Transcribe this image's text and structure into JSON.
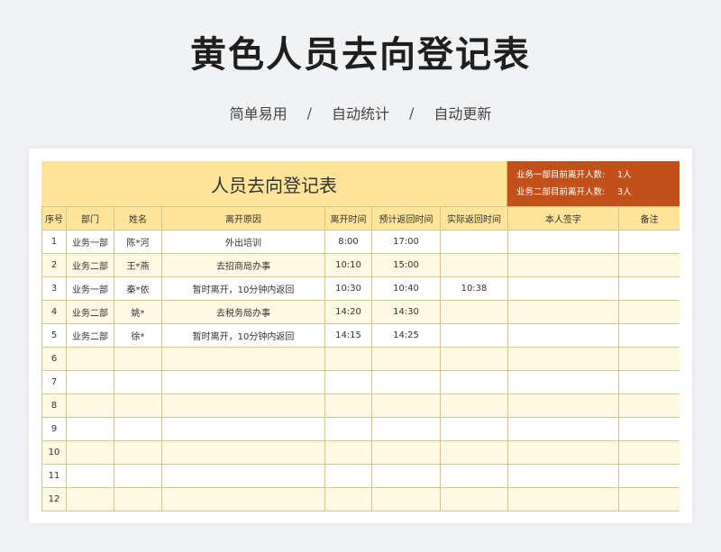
{
  "page": {
    "title": "黄色人员去向登记表",
    "tags": [
      "简单易用",
      "自动统计",
      "自动更新"
    ],
    "separator": "/"
  },
  "sheet": {
    "title": "人员去向登记表",
    "summary": [
      {
        "label": "业务一部目前离开人数:",
        "value": "1人"
      },
      {
        "label": "业务二部目前离开人数:",
        "value": "3人"
      }
    ],
    "columns": [
      "序号",
      "部门",
      "姓名",
      "离开原因",
      "离开时间",
      "预计返回时间",
      "实际返回时间",
      "本人签字",
      "备注"
    ],
    "rows": [
      [
        "1",
        "业务一部",
        "陈*河",
        "外出培训",
        "8:00",
        "17:00",
        "",
        "",
        ""
      ],
      [
        "2",
        "业务二部",
        "王*燕",
        "去招商局办事",
        "10:10",
        "15:00",
        "",
        "",
        ""
      ],
      [
        "3",
        "业务一部",
        "秦*依",
        "暂时离开，10分钟内返回",
        "10:30",
        "10:40",
        "10:38",
        "",
        ""
      ],
      [
        "4",
        "业务二部",
        "姚*",
        "去税务局办事",
        "14:20",
        "14:30",
        "",
        "",
        ""
      ],
      [
        "5",
        "业务二部",
        "徐*",
        "暂时离开，10分钟内返回",
        "14:15",
        "14:25",
        "",
        "",
        ""
      ],
      [
        "6",
        "",
        "",
        "",
        "",
        "",
        "",
        "",
        ""
      ],
      [
        "7",
        "",
        "",
        "",
        "",
        "",
        "",
        "",
        ""
      ],
      [
        "8",
        "",
        "",
        "",
        "",
        "",
        "",
        "",
        ""
      ],
      [
        "9",
        "",
        "",
        "",
        "",
        "",
        "",
        "",
        ""
      ],
      [
        "10",
        "",
        "",
        "",
        "",
        "",
        "",
        "",
        ""
      ],
      [
        "11",
        "",
        "",
        "",
        "",
        "",
        "",
        "",
        ""
      ],
      [
        "12",
        "",
        "",
        "",
        "",
        "",
        "",
        "",
        ""
      ]
    ]
  }
}
